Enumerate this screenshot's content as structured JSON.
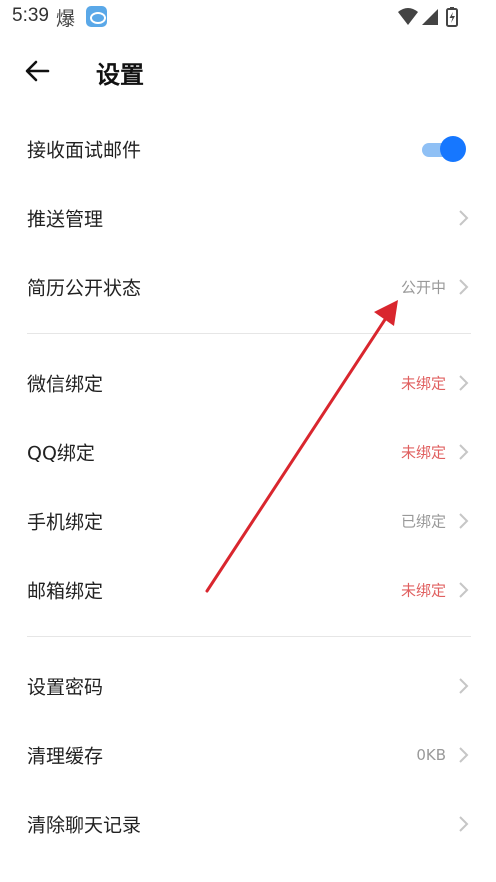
{
  "status_bar": {
    "time": "5:39",
    "notification_char": "爆"
  },
  "header": {
    "title": "设置"
  },
  "group1": [
    {
      "label": "接收面试邮件",
      "toggle_on": true
    },
    {
      "label": "推送管理",
      "value": ""
    },
    {
      "label": "简历公开状态",
      "value": "公开中"
    }
  ],
  "group2": [
    {
      "label": "微信绑定",
      "value": "未绑定"
    },
    {
      "label": "QQ绑定",
      "value": "未绑定"
    },
    {
      "label": "手机绑定",
      "value": "已绑定"
    },
    {
      "label": "邮箱绑定",
      "value": "未绑定"
    }
  ],
  "group3": [
    {
      "label": "设置密码",
      "value": ""
    },
    {
      "label": "清理缓存",
      "value": "0KB"
    },
    {
      "label": "清除聊天记录",
      "value": ""
    }
  ],
  "colors": {
    "accent": "#1677ff",
    "unbound": "#e06060",
    "annotation_arrow": "#d9262e"
  }
}
